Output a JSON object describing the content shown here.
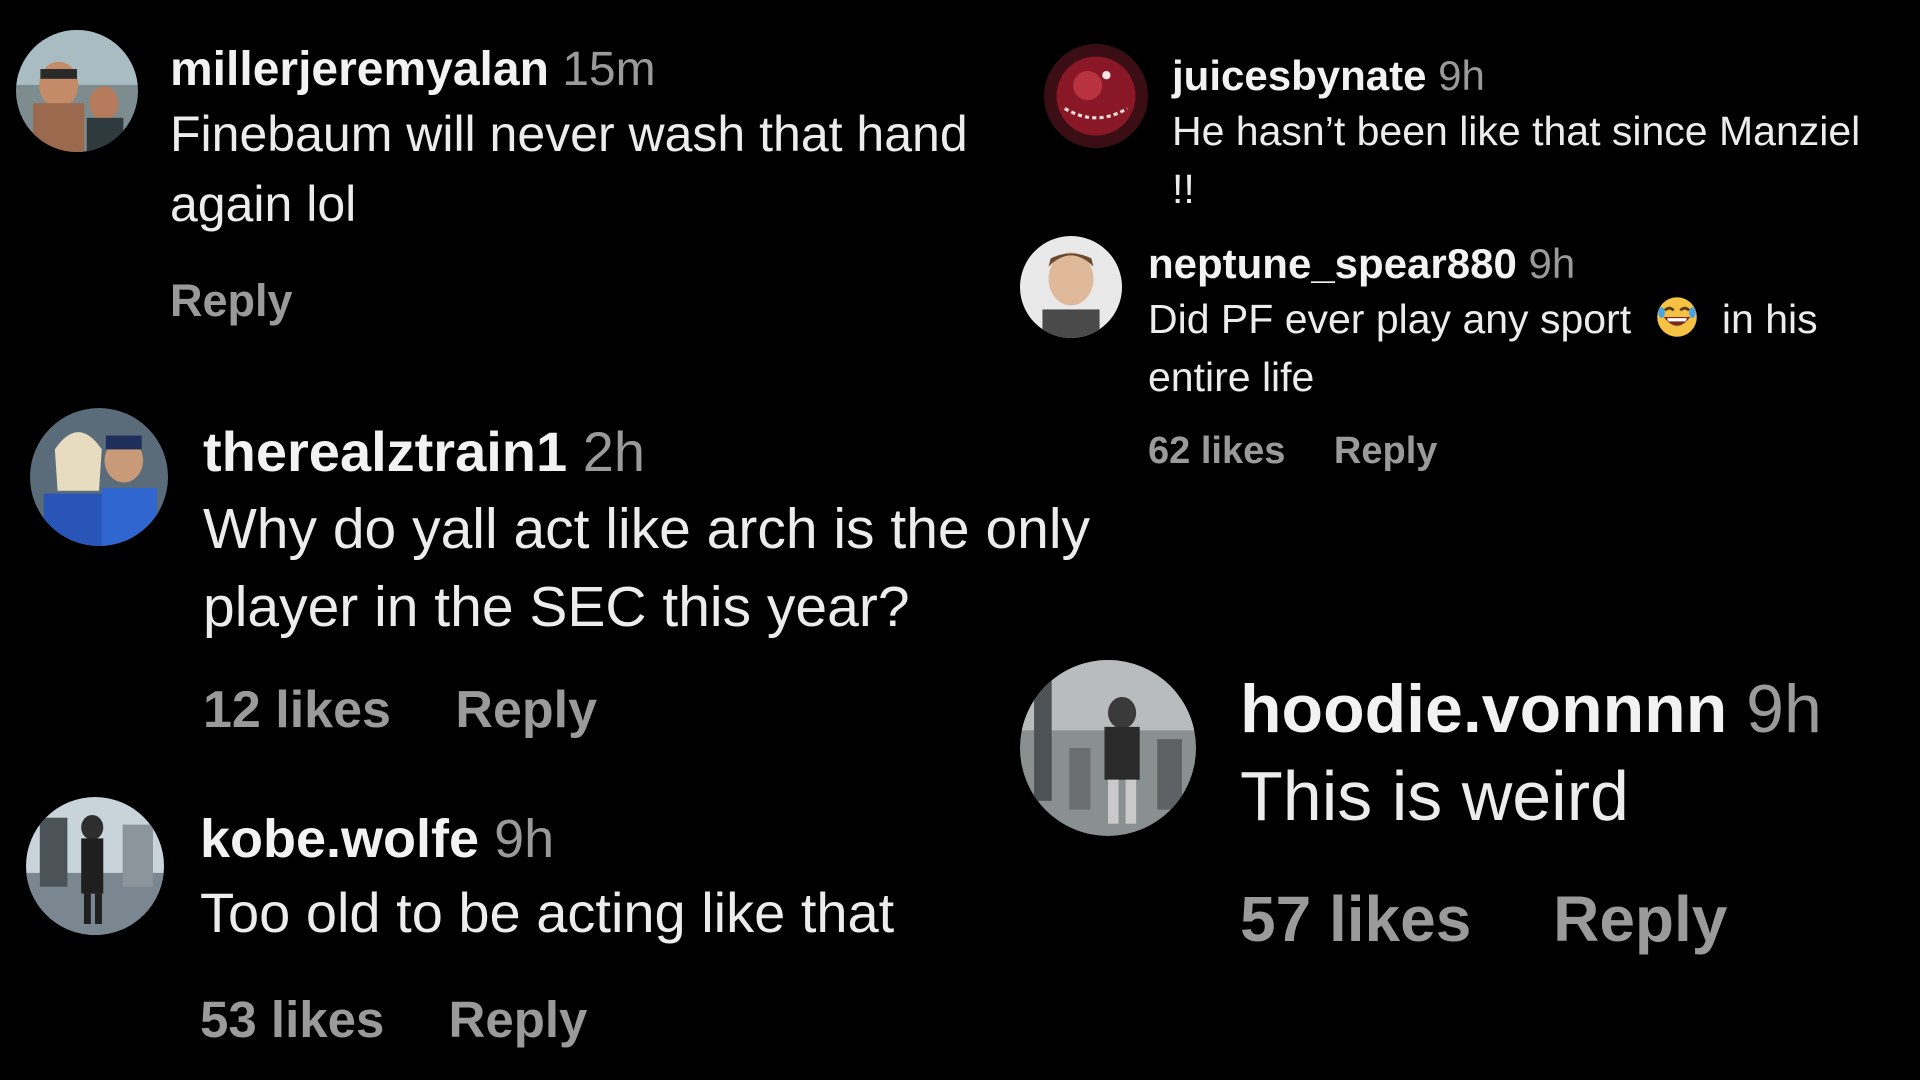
{
  "comments": [
    {
      "username": "millerjeremyalan",
      "time": "15m",
      "text_lines": [
        "Finebaum will never wash that hand",
        "again lol"
      ],
      "likes": "",
      "reply": "Reply",
      "avatar_icon": "user-avatar-photo"
    },
    {
      "username": "therealztrain1",
      "time": "2h",
      "text_lines": [
        "Why do yall act like arch is the only",
        "player in the SEC this year?"
      ],
      "likes": "12 likes",
      "reply": "Reply",
      "avatar_icon": "user-avatar-photo"
    },
    {
      "username": "kobe.wolfe",
      "time": "9h",
      "text_lines": [
        "Too old to be acting like that"
      ],
      "likes": "53 likes",
      "reply": "Reply",
      "avatar_icon": "user-avatar-photo"
    },
    {
      "username": "juicesbynate",
      "time": "9h",
      "text_lines": [
        "He hasn’t been like that since Manziel",
        "!!"
      ],
      "likes": "",
      "reply": "",
      "avatar_icon": "user-avatar-photo"
    },
    {
      "username": "neptune_spear880",
      "time": "9h",
      "text_before_emoji": "Did PF ever play any sport",
      "emoji_icon": "laughing-face-emoji",
      "text_after_emoji": "in his",
      "text_line2": "entire life",
      "likes": "62 likes",
      "reply": "Reply",
      "avatar_icon": "user-avatar-photo"
    },
    {
      "username": "hoodie.vonnnn",
      "time": "9h",
      "text_lines": [
        "This is weird"
      ],
      "likes": "57 likes",
      "reply": "Reply",
      "avatar_icon": "user-avatar-photo"
    }
  ],
  "colors": {
    "background": "#000000",
    "username": "#f2f2f2",
    "text": "#ececec",
    "muted": "#9a9a9a"
  }
}
